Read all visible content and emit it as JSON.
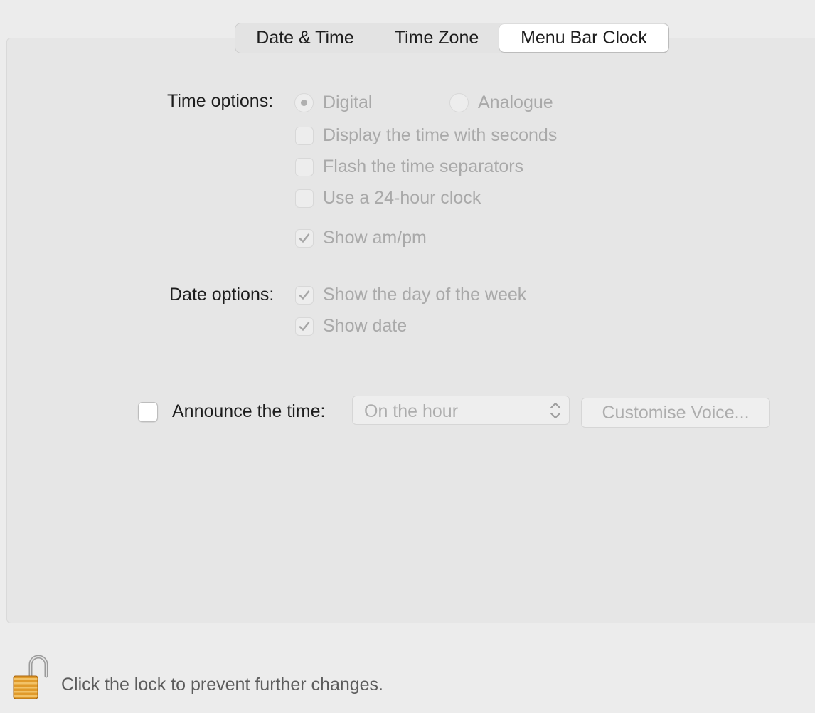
{
  "tabs": {
    "date_time": "Date & Time",
    "time_zone": "Time Zone",
    "menu_bar_clock": "Menu Bar Clock",
    "selected": "Menu Bar Clock"
  },
  "time_options": {
    "label": "Time options:",
    "digital": {
      "label": "Digital",
      "selected": true
    },
    "analogue": {
      "label": "Analogue",
      "selected": false
    },
    "display_seconds": {
      "label": "Display the time with seconds",
      "checked": false
    },
    "flash_separators": {
      "label": "Flash the time separators",
      "checked": false
    },
    "use_24_hour": {
      "label": "Use a 24-hour clock",
      "checked": false
    },
    "show_ampm": {
      "label": "Show am/pm",
      "checked": true
    }
  },
  "date_options": {
    "label": "Date options:",
    "show_day_of_week": {
      "label": "Show the day of the week",
      "checked": true
    },
    "show_date": {
      "label": "Show date",
      "checked": true
    }
  },
  "announce": {
    "checkbox_checked": false,
    "label": "Announce the time:",
    "interval_value": "On the hour",
    "customise_voice_button": "Customise Voice..."
  },
  "footer": {
    "lock_text": "Click the lock to prevent further changes."
  },
  "colors": {
    "window_background": "#ececec",
    "panel_background": "#e6e6e6",
    "disabled_text": "#a9a9a9",
    "lock_body": "#e09a2a"
  }
}
